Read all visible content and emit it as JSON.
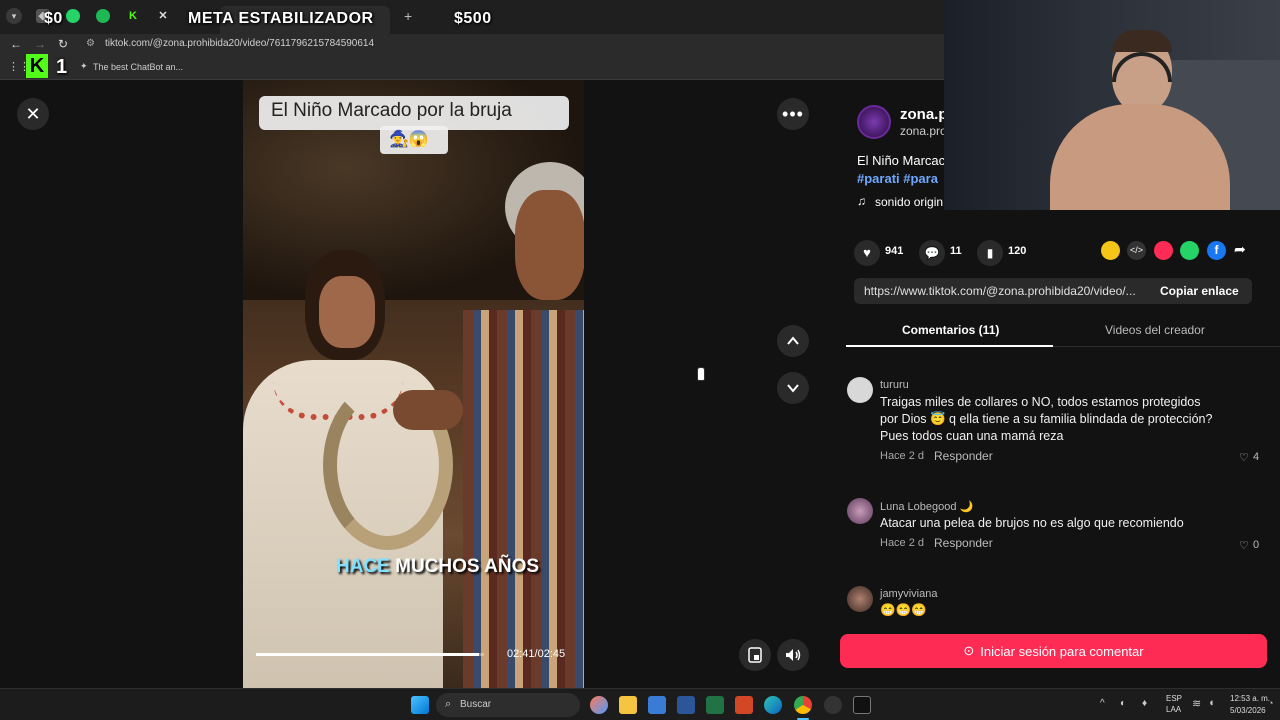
{
  "overlay": {
    "left_amount": "$0",
    "goal_label": "META ESTABILIZADOR",
    "right_amount": "$500",
    "channel_number": "1"
  },
  "browser": {
    "url": "tiktok.com/@zona.prohibida20/video/7611796215784590614",
    "bookmark_label": "The best ChatBot an..."
  },
  "video": {
    "title_line": "El Niño Marcado por la bruja",
    "title_emoji": "🧙‍♀️😱",
    "caption_highlight": "HACE",
    "caption_rest": "MUCHOS AÑOS",
    "time": "02:41/02:45",
    "progress": 0.98
  },
  "creator": {
    "name": "zona.p",
    "handle": "zona.pro",
    "desc": "El Niño Marcac",
    "tags": "#parati #para",
    "sound": "sonido origin"
  },
  "stats": {
    "likes": "941",
    "comments": "11",
    "saves": "120"
  },
  "share": {
    "link": "https://www.tiktok.com/@zona.prohibida20/video/...",
    "copy_label": "Copiar enlace"
  },
  "tabs": {
    "comments": "Comentarios (11)",
    "creator_videos": "Videos del creador"
  },
  "comments": [
    {
      "user": "tururu",
      "text": "Traigas miles de collares o NO, todos estamos protegidos por Dios 😇 q ella tiene a su familia blindada de protección? Pues todos cuan una mamá reza",
      "time": "Hace 2 d",
      "reply": "Responder",
      "likes": "4"
    },
    {
      "user": "Luna Lobegood 🌙",
      "text": "Atacar una pelea de brujos no es algo que recomiendo",
      "time": "Hace 2 d",
      "reply": "Responder",
      "likes": "0"
    },
    {
      "user": "jamyviviana",
      "text": "😁😁😁"
    }
  ],
  "login_button": "Iniciar sesión para comentar",
  "taskbar": {
    "search_placeholder": "Buscar",
    "lang": "ESP",
    "lang2": "LAA",
    "clock_time": "12:53 a. m.",
    "clock_date": "5/03/2026"
  },
  "colors": {
    "accent": "#fe2c55",
    "tag_blue": "#6ea8fe",
    "overlay_green": "#00e701"
  }
}
